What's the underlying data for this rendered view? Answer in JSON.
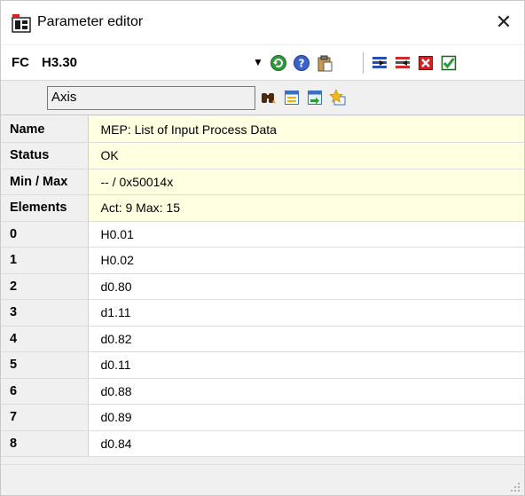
{
  "window": {
    "title": "Parameter editor",
    "close_glyph": "✕"
  },
  "toolbar": {
    "fc_label": "FC",
    "fc_value": "H3.30",
    "dropdown_glyph": "▼",
    "icons": [
      "refresh-icon",
      "help-icon",
      "paste-icon",
      "insert-after-icon",
      "insert-before-icon",
      "delete-icon",
      "accept-icon"
    ]
  },
  "search": {
    "axis_value": "Axis",
    "icons": [
      "find-binoculars-icon",
      "select-all-icon",
      "import-icon",
      "favorite-star-icon"
    ]
  },
  "info": {
    "name": {
      "label": "Name",
      "value": "MEP: List of Input Process Data"
    },
    "status": {
      "label": "Status",
      "value": "OK"
    },
    "minmax": {
      "label": "Min / Max",
      "value": "-- / 0x50014x"
    },
    "elements": {
      "label": "Elements",
      "value": "Act: 9  Max: 15"
    }
  },
  "elements": [
    {
      "index": "0",
      "value": "H0.01"
    },
    {
      "index": "1",
      "value": "H0.02"
    },
    {
      "index": "2",
      "value": "d0.80"
    },
    {
      "index": "3",
      "value": "d1.11"
    },
    {
      "index": "4",
      "value": "d0.82"
    },
    {
      "index": "5",
      "value": "d0.11"
    },
    {
      "index": "6",
      "value": "d0.88"
    },
    {
      "index": "7",
      "value": "d0.89"
    },
    {
      "index": "8",
      "value": "d0.84"
    }
  ],
  "colors": {
    "info_row_bg": "#ffffe1",
    "window_bg": "#f0f0f0"
  }
}
